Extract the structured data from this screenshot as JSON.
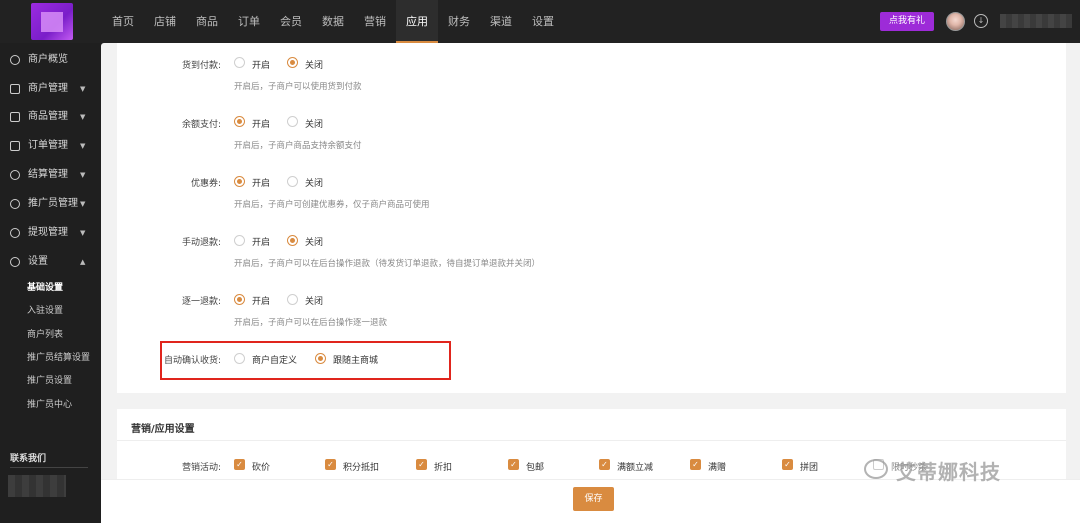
{
  "topnav": {
    "items": [
      "首页",
      "店铺",
      "商品",
      "订单",
      "会员",
      "数据",
      "营销",
      "应用",
      "财务",
      "渠道",
      "设置"
    ],
    "active_index": 7,
    "gift_button": "点我有礼"
  },
  "sidebar": {
    "items": [
      {
        "label": "商户概览",
        "icon": "target-icon"
      },
      {
        "label": "商户管理",
        "icon": "store-icon"
      },
      {
        "label": "商品管理",
        "icon": "product-icon"
      },
      {
        "label": "订单管理",
        "icon": "order-icon"
      },
      {
        "label": "结算管理",
        "icon": "settlement-icon"
      },
      {
        "label": "推广员管理",
        "icon": "promoter-icon"
      },
      {
        "label": "提现管理",
        "icon": "withdraw-icon"
      },
      {
        "label": "设置",
        "icon": "settings-icon"
      }
    ],
    "sub_items": [
      "基础设置",
      "入驻设置",
      "商户列表",
      "推广员结算设置",
      "推广员设置",
      "推广员中心"
    ],
    "active_sub_index": 0,
    "contact": "联系我们"
  },
  "settings": {
    "rows": [
      {
        "label": "货到付款:",
        "opt1": "开启",
        "opt2": "关闭",
        "selected": 2,
        "hint": "开启后，子商户可以使用货到付款"
      },
      {
        "label": "余额支付:",
        "opt1": "开启",
        "opt2": "关闭",
        "selected": 1,
        "hint": "开启后，子商户商品支持余额支付"
      },
      {
        "label": "优惠券:",
        "opt1": "开启",
        "opt2": "关闭",
        "selected": 1,
        "hint": "开启后，子商户可创建优惠券，仅子商户商品可使用"
      },
      {
        "label": "手动退款:",
        "opt1": "开启",
        "opt2": "关闭",
        "selected": 2,
        "hint": "开启后，子商户可以在后台操作退款（待发货订单退款，待自提订单退款并关闭）"
      },
      {
        "label": "逐一退款:",
        "opt1": "开启",
        "opt2": "关闭",
        "selected": 1,
        "hint": "开启后，子商户可以在后台操作逐一退款"
      }
    ],
    "auto_confirm": {
      "label": "自动确认收货:",
      "opt1": "商户自定义",
      "opt2": "跟随主商城",
      "selected": 2
    }
  },
  "marketing": {
    "title": "营销/应用设置",
    "row_label": "营销活动:",
    "items": [
      "砍价",
      "积分抵扣",
      "折扣",
      "包邮",
      "满额立减",
      "满赠",
      "拼团",
      "限时秒杀"
    ]
  },
  "save_label": "保存",
  "watermark": "艾蒂娜科技"
}
